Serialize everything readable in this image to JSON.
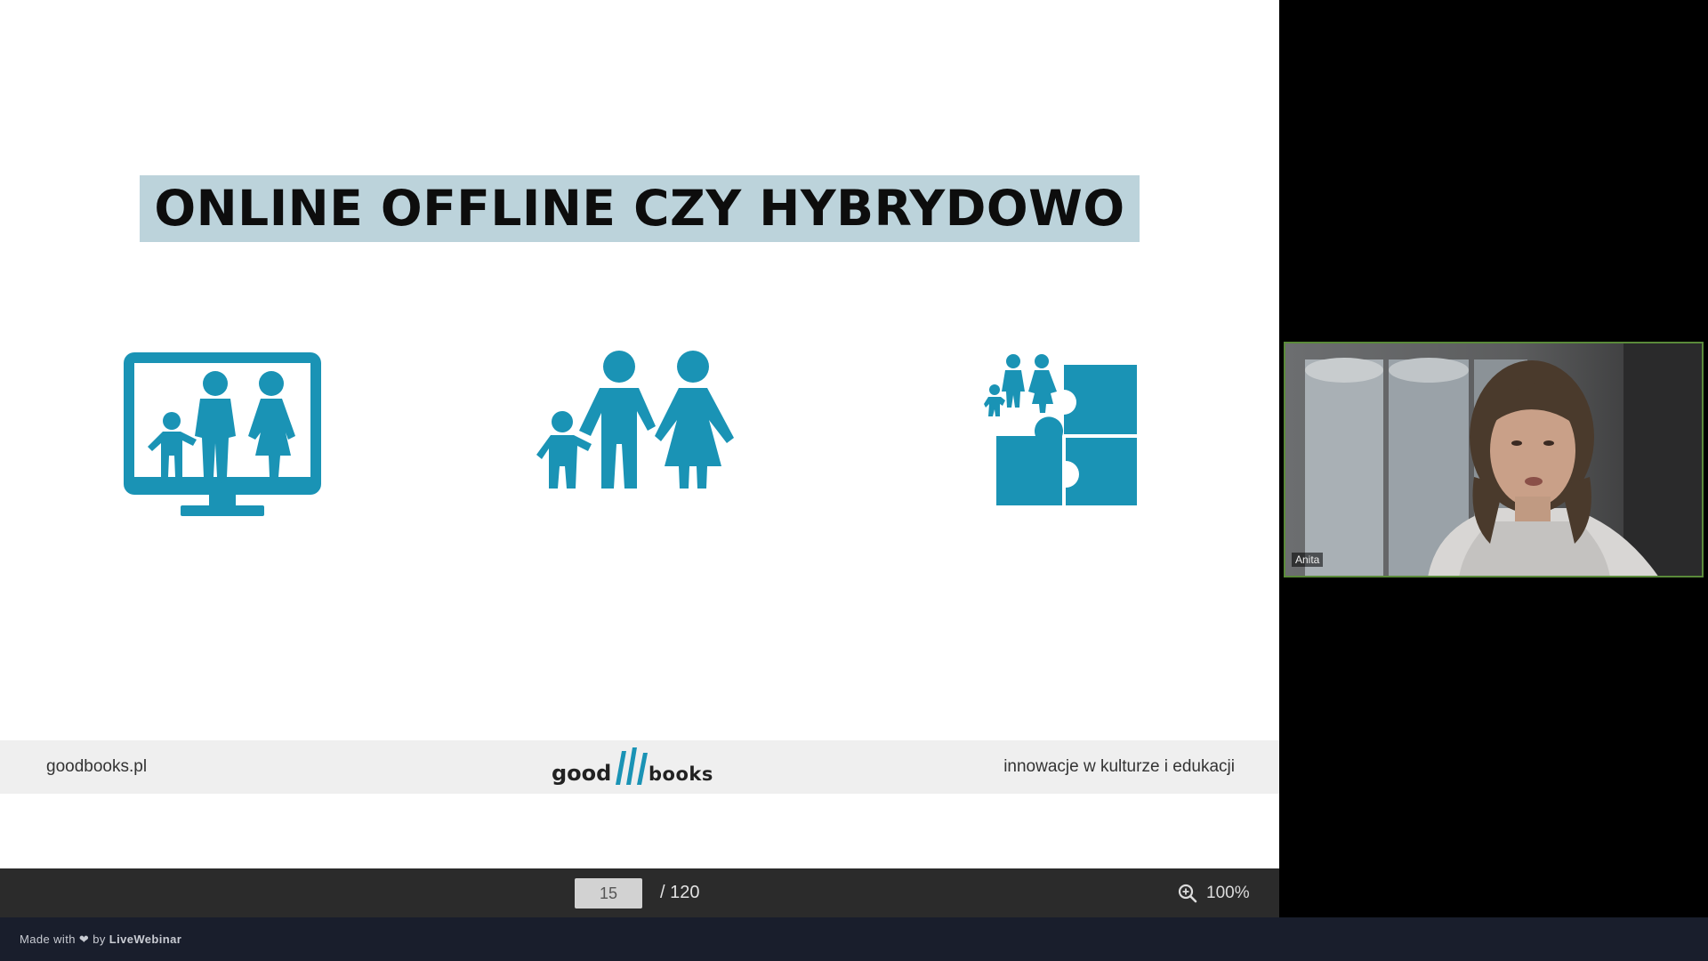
{
  "slide": {
    "title": "ONLINE OFFLINE CZY HYBRYDOWO",
    "icons": [
      "family-monitor-icon",
      "family-icon",
      "family-puzzle-icon"
    ],
    "accent_color": "#1a93b5",
    "footer": {
      "left": "goodbooks.pl",
      "logo_left": "good",
      "logo_right": "books",
      "right": "innowacje w kulturze i edukacji"
    }
  },
  "pager": {
    "current_page": "15",
    "total": "/ 120",
    "zoom": "100%"
  },
  "webcam": {
    "participant_name": "Anita"
  },
  "branding": {
    "prefix": "Made with",
    "heart": "❤",
    "middle": "by",
    "brand": "LiveWebinar"
  }
}
